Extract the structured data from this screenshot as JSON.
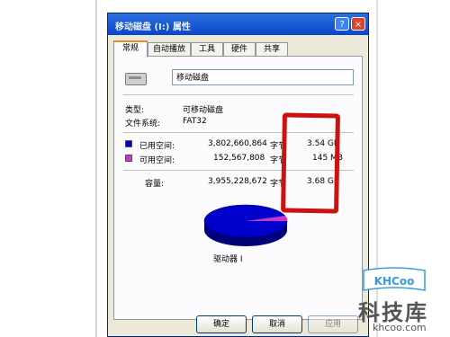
{
  "window": {
    "title": "移动磁盘 (I:) 属性",
    "help_label": "?",
    "close_label": "×"
  },
  "tabs": [
    {
      "label": "常规",
      "active": true
    },
    {
      "label": "自动播放",
      "active": false
    },
    {
      "label": "工具",
      "active": false
    },
    {
      "label": "硬件",
      "active": false
    },
    {
      "label": "共享",
      "active": false
    }
  ],
  "general": {
    "drive_name": "移动磁盘",
    "type_label": "类型:",
    "type_value": "可移动磁盘",
    "fs_label": "文件系统:",
    "fs_value": "FAT32",
    "used": {
      "label": "已用空间:",
      "bytes": "3,802,660,864",
      "unit": "字节",
      "size": "3.54 GB",
      "color": "#0000cc"
    },
    "free": {
      "label": "可用空间:",
      "bytes": "152,567,808",
      "unit": "字节",
      "size": "145 MB",
      "color": "#cc33cc"
    },
    "capacity": {
      "label": "容量:",
      "bytes": "3,955,228,672",
      "unit": "字节",
      "size": "3.68 GB"
    },
    "drive_caption": "驱动器 I"
  },
  "buttons": {
    "ok": "确定",
    "cancel": "取消",
    "apply": "应用"
  },
  "watermark": {
    "logo_text": "KHCoo",
    "name": "科技库",
    "url": "khcoo.com"
  },
  "colors": {
    "titlebar": "#0a46c8",
    "annotation": "#cc1111",
    "used_slice": "#0000cc",
    "free_slice": "#cc33cc"
  }
}
